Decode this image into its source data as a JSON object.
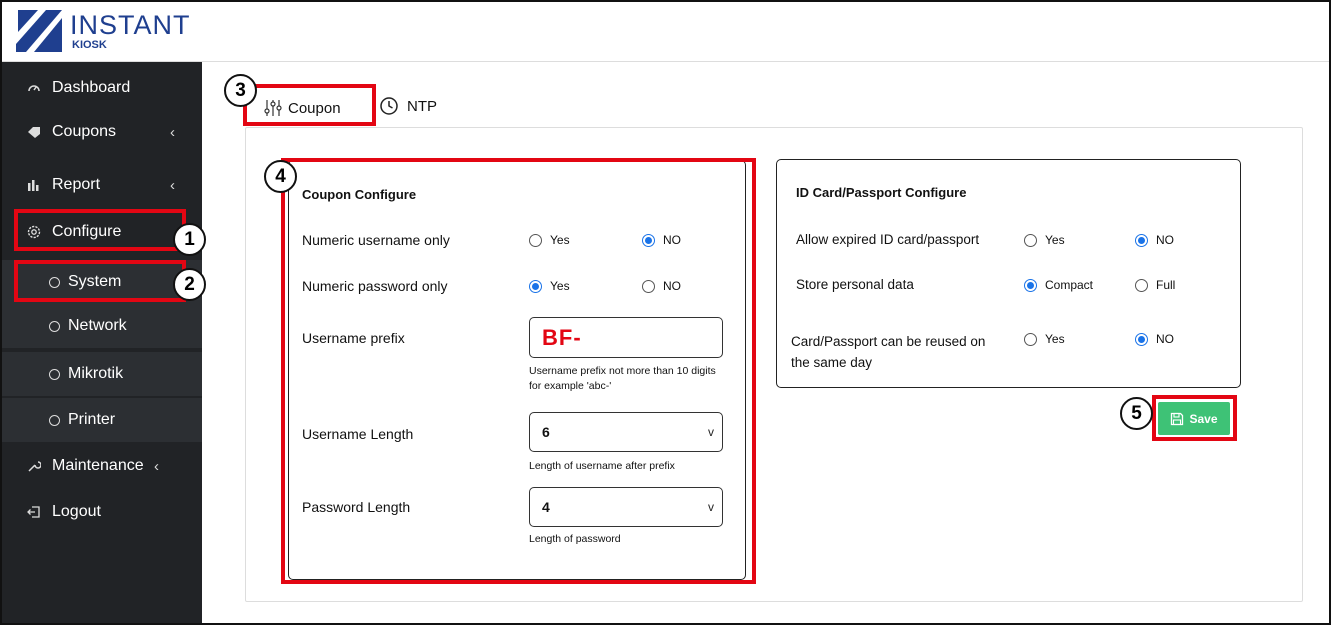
{
  "brand": {
    "name": "INSTANT",
    "sub": "KIOSK",
    "color": "#1f3f8f"
  },
  "sidebar": {
    "items": [
      {
        "label": "Dashboard",
        "icon": "gauge-icon"
      },
      {
        "label": "Coupons",
        "icon": "tag-icon",
        "chevron": "‹"
      },
      {
        "label": "Report",
        "icon": "bar-chart-icon",
        "chevron": "‹"
      },
      {
        "label": "Configure",
        "icon": "gear-icon"
      },
      {
        "label": "System",
        "icon": "circle-icon"
      },
      {
        "label": "Network",
        "icon": "circle-icon"
      },
      {
        "label": "Mikrotik",
        "icon": "circle-icon"
      },
      {
        "label": "Printer",
        "icon": "circle-icon"
      },
      {
        "label": "Maintenance",
        "icon": "wrench-icon",
        "chevron": "‹"
      },
      {
        "label": "Logout",
        "icon": "logout-icon"
      }
    ]
  },
  "badges": [
    "1",
    "2",
    "3",
    "4",
    "5"
  ],
  "tabs": [
    {
      "label": "Coupon",
      "icon": "sliders-icon",
      "active": true
    },
    {
      "label": "NTP",
      "icon": "clock-icon",
      "active": false
    }
  ],
  "coupon_card": {
    "title": "Coupon Configure",
    "rows": [
      {
        "label": "Numeric username only",
        "options": [
          "Yes",
          "NO"
        ],
        "selected": "NO"
      },
      {
        "label": "Numeric password only",
        "options": [
          "Yes",
          "NO"
        ],
        "selected": "Yes"
      }
    ],
    "prefix": {
      "label": "Username prefix",
      "value": "BF-",
      "hint": "Username prefix not more than 10 digits for example 'abc-'"
    },
    "username_length": {
      "label": "Username Length",
      "value": "6",
      "hint": "Length of username after prefix"
    },
    "password_length": {
      "label": "Password Length",
      "value": "4",
      "hint": "Length of password"
    }
  },
  "id_card": {
    "title": "ID Card/Passport Configure",
    "rows": [
      {
        "label": "Allow expired ID card/passport",
        "options": [
          "Yes",
          "NO"
        ],
        "selected": "NO"
      },
      {
        "label": "Store personal data",
        "options": [
          "Compact",
          "Full"
        ],
        "selected": "Compact"
      },
      {
        "label": "Card/Passport can be reused on the same day",
        "options": [
          "Yes",
          "NO"
        ],
        "selected": "NO"
      }
    ]
  },
  "save_label": "Save",
  "colors": {
    "sidebar": "#212326",
    "highlight": "#e30613",
    "save": "#3ec276",
    "radio": "#1a73e8"
  }
}
